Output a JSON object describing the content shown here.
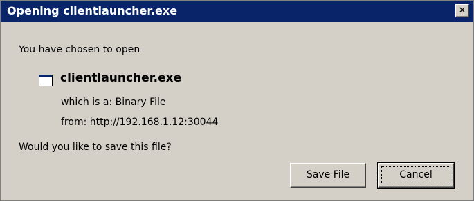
{
  "dialog": {
    "title": "Opening clientlauncher.exe",
    "close_glyph": "✕",
    "intro": "You have chosen to open",
    "file_icon": "application-window-icon",
    "file_name": "clientlauncher.exe",
    "type_label": "which is a:",
    "type_value": "Binary File",
    "from_label": "from:",
    "from_value": "http://192.168.1.12:30044",
    "question": "Would you like to save this file?",
    "buttons": {
      "save": "Save File",
      "cancel": "Cancel"
    }
  },
  "colors": {
    "titlebar": "#0a246a",
    "title_text": "#ffffff",
    "face": "#d4d0c8"
  }
}
